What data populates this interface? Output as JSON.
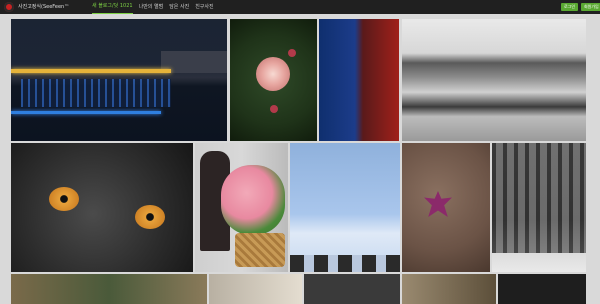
{
  "header": {
    "brand": "사진고정식(SeeFeen™",
    "nav": [
      {
        "label": "새 블로그/덧 1021",
        "active": true
      },
      {
        "label": "나만의 앨범",
        "active": false
      },
      {
        "label": "담은 사진",
        "active": false
      },
      {
        "label": "친구사진",
        "active": false
      }
    ],
    "login_label": "로그인",
    "signup_label": "회원가입"
  },
  "gallery": {
    "photos": [
      {
        "subject": "night-bridge"
      },
      {
        "subject": "pink-rose"
      },
      {
        "subject": "blue-red-abstract"
      },
      {
        "subject": "river-landscape"
      },
      {
        "subject": "black-cat"
      },
      {
        "subject": "woman-with-flowers"
      },
      {
        "subject": "sky-with-posts"
      },
      {
        "subject": "autumn-leaves"
      },
      {
        "subject": "snowy-forest"
      }
    ]
  },
  "colors": {
    "accent": "#7ccf44",
    "button": "#5aa832",
    "topbar": "#202020",
    "background": "#d9d9d9"
  }
}
